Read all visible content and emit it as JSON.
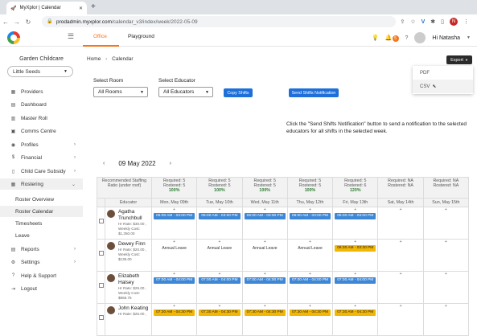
{
  "browser": {
    "tab_title": "MyXplor | Calendar",
    "url_host": "prodadmin.myxplor.com",
    "url_path": "/calendar_v3/index/week/2022-05-09",
    "profile_initial": "N"
  },
  "topbar": {
    "tabs": [
      "Office",
      "Playground"
    ],
    "notif_count": "5",
    "greeting": "Hi Natasha"
  },
  "sidebar": {
    "org_name": "Garden Childcare",
    "service": "Little Seeds",
    "items": [
      {
        "label": "Providers",
        "icon": "building-icon"
      },
      {
        "label": "Dashboard",
        "icon": "dashboard-icon"
      },
      {
        "label": "Master Roll",
        "icon": "list-icon"
      },
      {
        "label": "Comms Centre",
        "icon": "chat-icon"
      },
      {
        "label": "Profiles",
        "icon": "person-icon"
      },
      {
        "label": "Financial",
        "icon": "dollar-icon"
      },
      {
        "label": "Child Care Subsidy",
        "icon": "document-icon"
      },
      {
        "label": "Rostering",
        "icon": "calendar-icon"
      },
      {
        "label": "Roster Overview"
      },
      {
        "label": "Roster Calendar"
      },
      {
        "label": "Timesheets"
      },
      {
        "label": "Leave"
      },
      {
        "label": "Reports",
        "icon": "chart-icon"
      },
      {
        "label": "Settings",
        "icon": "gear-icon"
      },
      {
        "label": "Help & Support",
        "icon": "help-icon"
      },
      {
        "label": "Logout",
        "icon": "logout-icon"
      }
    ]
  },
  "main": {
    "breadcrumb": [
      "Home",
      "Calendar"
    ],
    "export_label": "Export",
    "export_options": [
      "PDF",
      "CSV"
    ],
    "select_room_label": "Select Room",
    "select_room_value": "All Rooms",
    "select_educator_label": "Select Educator",
    "select_educator_value": "All Educators",
    "copy_shifts": "Copy Shifts",
    "send_notification": "Send Shifts Notification",
    "note": "Click the \"Send Shifts Notification\" button to send a notification to the selected educators for all shifts in the selected week.",
    "week_label": "09 May 2022"
  },
  "roster": {
    "header_first": "Recommended Staffing Ratio (under roof)",
    "educator_col": "Educator",
    "days": [
      {
        "req": "Required: 5",
        "rost": "Rostered: 5",
        "pct": "100%",
        "name": "Mon, May 09th"
      },
      {
        "req": "Required: 5",
        "rost": "Rostered: 5",
        "pct": "100%",
        "name": "Tue, May 10th"
      },
      {
        "req": "Required: 5",
        "rost": "Rostered: 5",
        "pct": "100%",
        "name": "Wed, May 11th"
      },
      {
        "req": "Required: 5",
        "rost": "Rostered: 5",
        "pct": "100%",
        "name": "Thu, May 12th"
      },
      {
        "req": "Required: 5",
        "rost": "Rostered: 6",
        "pct": "120%",
        "name": "Fri, May 13th"
      },
      {
        "req": "Required: NA",
        "rost": "Rostered: NA",
        "pct": "",
        "name": "Sat, May 14th"
      },
      {
        "req": "Required: NA",
        "rost": "Rostered: NA",
        "pct": "",
        "name": "Sun, May 15th"
      }
    ],
    "employees": [
      {
        "name": "Agatha Trunchbull",
        "rate": "Hr Rate: $30.00 ,",
        "cost": "Weekly Cost: $1,350.00",
        "shifts": [
          [
            "blue",
            "06:00 AM - 03:00 PM"
          ],
          [
            "blue",
            "06:00 AM - 03:00 PM"
          ],
          [
            "blue",
            "06:00 AM - 03:00 PM"
          ],
          [
            "blue",
            "06:00 AM - 03:00 PM"
          ],
          [
            "blue",
            "06:00 AM - 03:00 PM"
          ],
          [
            "",
            ""
          ],
          [
            "",
            ""
          ]
        ]
      },
      {
        "name": "Dewey Finn",
        "rate": "Hr Rate: $20.00 ,",
        "cost": "Weekly Cost: $135.00",
        "shifts": [
          [
            "leave",
            "Annual Leave"
          ],
          [
            "leave",
            "Annual Leave"
          ],
          [
            "leave",
            "Annual Leave"
          ],
          [
            "leave",
            "Annual Leave"
          ],
          [
            "yellow",
            "06:30 AM - 03:30 PM"
          ],
          [
            "",
            ""
          ],
          [
            "",
            ""
          ]
        ]
      },
      {
        "name": "Elizabeth Halsey",
        "rate": "Hr Rate: $25.00 ,",
        "cost": "Weekly Cost: $968.75",
        "shifts": [
          [
            "blue",
            "07:00 AM - 04:00 PM"
          ],
          [
            "blue",
            "07:00 AM - 04:00 PM"
          ],
          [
            "blue",
            "07:00 AM - 04:00 PM"
          ],
          [
            "blue",
            "07:00 AM - 04:00 PM"
          ],
          [
            "blue",
            "07:00 AM - 04:00 PM"
          ],
          [
            "",
            ""
          ],
          [
            "",
            ""
          ]
        ]
      },
      {
        "name": "John Keating",
        "rate": "Hr Rate: $25.00 ,",
        "cost": "",
        "shifts": [
          [
            "yellow",
            "07:30 AM - 04:30 PM"
          ],
          [
            "yellow",
            "07:30 AM - 04:30 PM"
          ],
          [
            "yellow",
            "07:30 AM - 04:30 PM"
          ],
          [
            "yellow",
            "07:30 AM - 04:30 PM"
          ],
          [
            "yellow",
            "07:30 AM - 04:30 PM"
          ],
          [
            "",
            ""
          ],
          [
            "",
            ""
          ]
        ]
      }
    ]
  },
  "colors": {
    "accent": "#f5761a",
    "primary_button": "#1e6fd9",
    "shift_blue": "#3d87d6",
    "shift_yellow": "#f2b705"
  }
}
